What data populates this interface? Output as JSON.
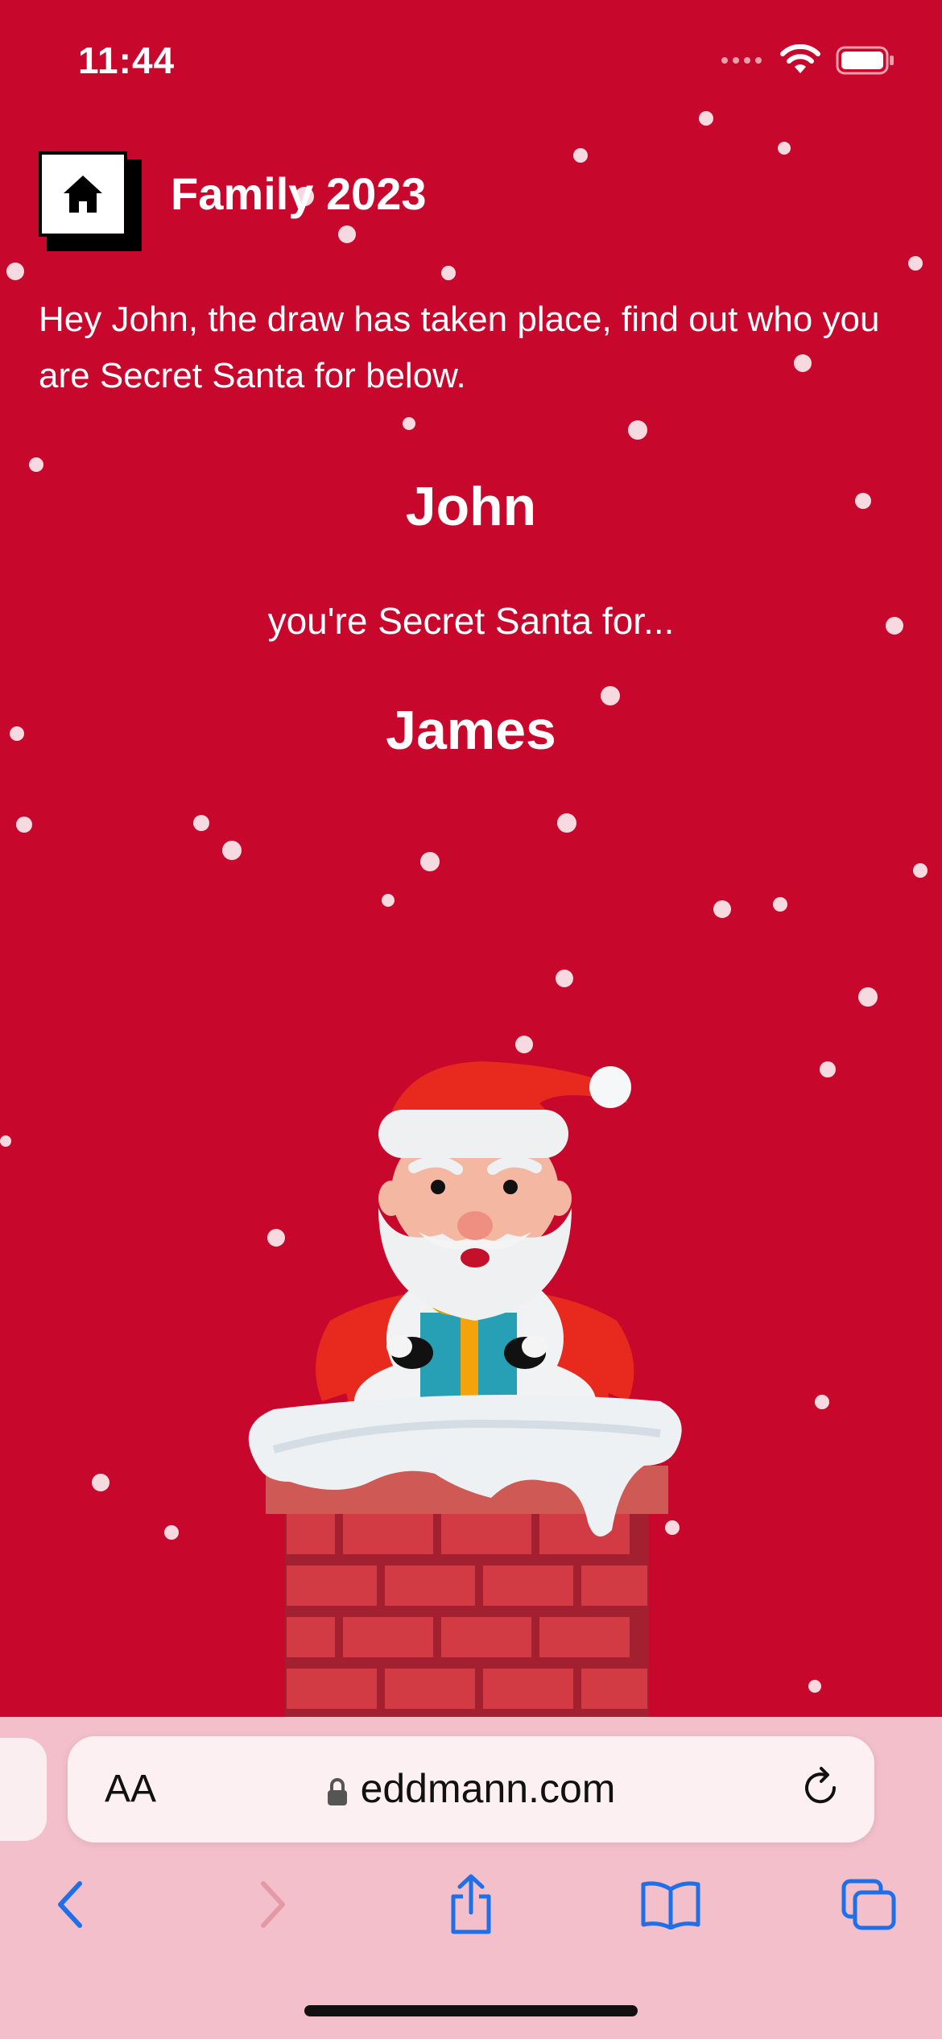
{
  "status": {
    "time": "11:44"
  },
  "header": {
    "title": "Family 2023",
    "home_icon": "home-icon"
  },
  "intro": "Hey John, the draw has taken place, find out who you are Secret Santa for below.",
  "draw": {
    "giver": "John",
    "subtitle": "you're Secret Santa for...",
    "recipient": "James"
  },
  "browser": {
    "aa_label": "AA",
    "url": "eddmann.com",
    "tint_color": "#1f6fe8",
    "disabled_color": "#e39aa7"
  },
  "colors": {
    "background": "#c8072c",
    "text": "#ffffff"
  }
}
